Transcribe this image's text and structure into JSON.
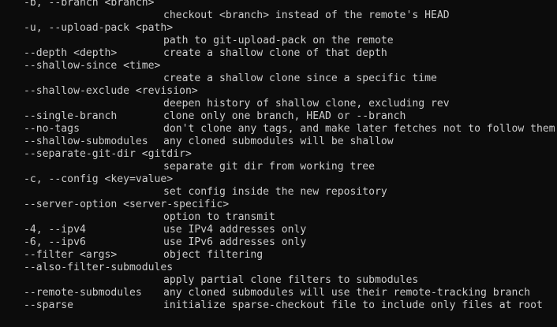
{
  "lines": [
    {
      "opt": "-b, --branch <branch>",
      "desc": ""
    },
    {
      "opt": "",
      "desc": "checkout <branch> instead of the remote's HEAD"
    },
    {
      "opt": "-u, --upload-pack <path>",
      "desc": ""
    },
    {
      "opt": "",
      "desc": "path to git-upload-pack on the remote"
    },
    {
      "opt": "--depth <depth>",
      "desc": "create a shallow clone of that depth"
    },
    {
      "opt": "--shallow-since <time>",
      "desc": ""
    },
    {
      "opt": "",
      "desc": "create a shallow clone since a specific time"
    },
    {
      "opt": "--shallow-exclude <revision>",
      "desc": ""
    },
    {
      "opt": "",
      "desc": "deepen history of shallow clone, excluding rev"
    },
    {
      "opt": "--single-branch",
      "desc": "clone only one branch, HEAD or --branch"
    },
    {
      "opt": "--no-tags",
      "desc": "don't clone any tags, and make later fetches not to follow them"
    },
    {
      "opt": "--shallow-submodules",
      "desc": "any cloned submodules will be shallow"
    },
    {
      "opt": "--separate-git-dir <gitdir>",
      "desc": ""
    },
    {
      "opt": "",
      "desc": "separate git dir from working tree"
    },
    {
      "opt": "-c, --config <key=value>",
      "desc": ""
    },
    {
      "opt": "",
      "desc": "set config inside the new repository"
    },
    {
      "opt": "--server-option <server-specific>",
      "desc": ""
    },
    {
      "opt": "",
      "desc": "option to transmit"
    },
    {
      "opt": "-4, --ipv4",
      "desc": "use IPv4 addresses only"
    },
    {
      "opt": "-6, --ipv6",
      "desc": "use IPv6 addresses only"
    },
    {
      "opt": "--filter <args>",
      "desc": "object filtering"
    },
    {
      "opt": "--also-filter-submodules",
      "desc": ""
    },
    {
      "opt": "",
      "desc": "apply partial clone filters to submodules"
    },
    {
      "opt": "--remote-submodules",
      "desc": "any cloned submodules will use their remote-tracking branch"
    },
    {
      "opt": "--sparse",
      "desc": "initialize sparse-checkout file to include only files at root"
    }
  ]
}
